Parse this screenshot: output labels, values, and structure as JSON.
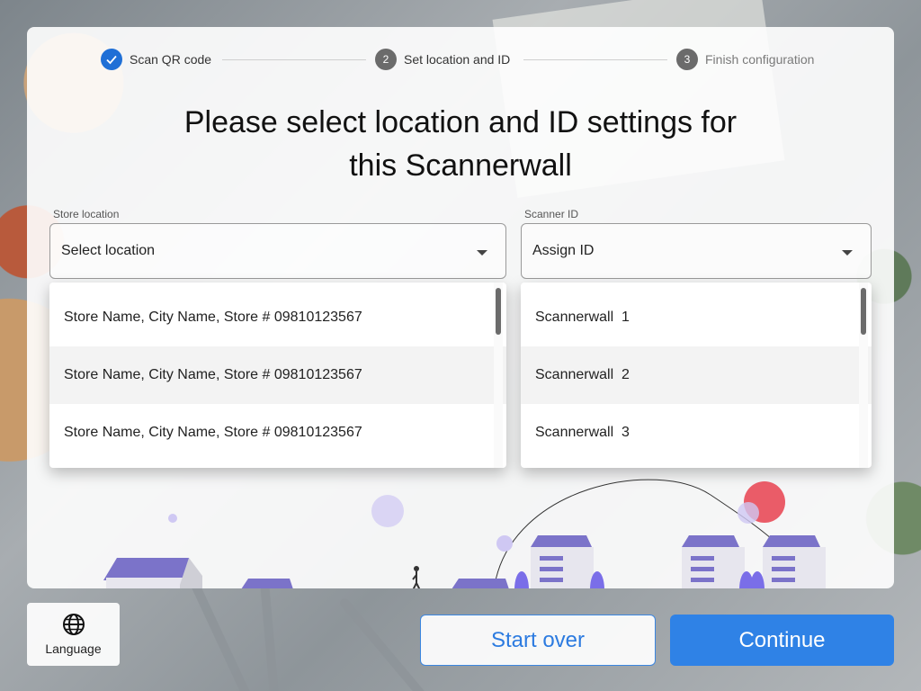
{
  "stepper": {
    "steps": [
      {
        "label": "Scan QR code",
        "number": "✓",
        "state": "done"
      },
      {
        "label": "Set location and ID",
        "number": "2",
        "state": "active"
      },
      {
        "label": "Finish configuration",
        "number": "3",
        "state": "inactive"
      }
    ]
  },
  "title_line1": "Please select location and ID settings for",
  "title_line2": "this Scannerwall",
  "store": {
    "label": "Store location",
    "placeholder": "Select location",
    "options": [
      "Store Name, City Name, Store # 09810123567",
      "Store Name, City Name, Store # 09810123567",
      "Store Name, City Name, Store # 09810123567"
    ]
  },
  "scanner": {
    "label": "Scanner ID",
    "placeholder": "Assign ID",
    "options": [
      "Scannerwall  1",
      "Scannerwall  2",
      "Scannerwall  3"
    ]
  },
  "language_label": "Language",
  "buttons": {
    "start_over": "Start over",
    "continue": "Continue"
  },
  "colors": {
    "primary": "#2f82e6",
    "step_done": "#1f6fd6",
    "illustration": "#7b73c9",
    "accent_red": "#e8414f"
  }
}
